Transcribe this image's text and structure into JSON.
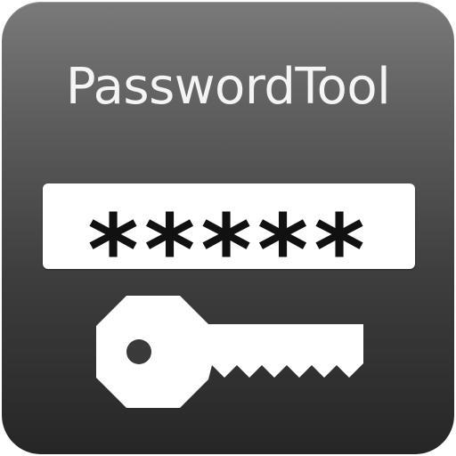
{
  "app": {
    "title": "PasswordTool",
    "password_mask": "*****"
  },
  "icons": {
    "key": "key-icon"
  },
  "colors": {
    "tile_top": "#7a7a7a",
    "tile_bottom": "#262626",
    "title_text": "#f4f4f4",
    "field_background": "#ffffff",
    "mask_text": "#111111",
    "key_fill": "#ffffff",
    "key_hole": "#3a3a3a"
  }
}
